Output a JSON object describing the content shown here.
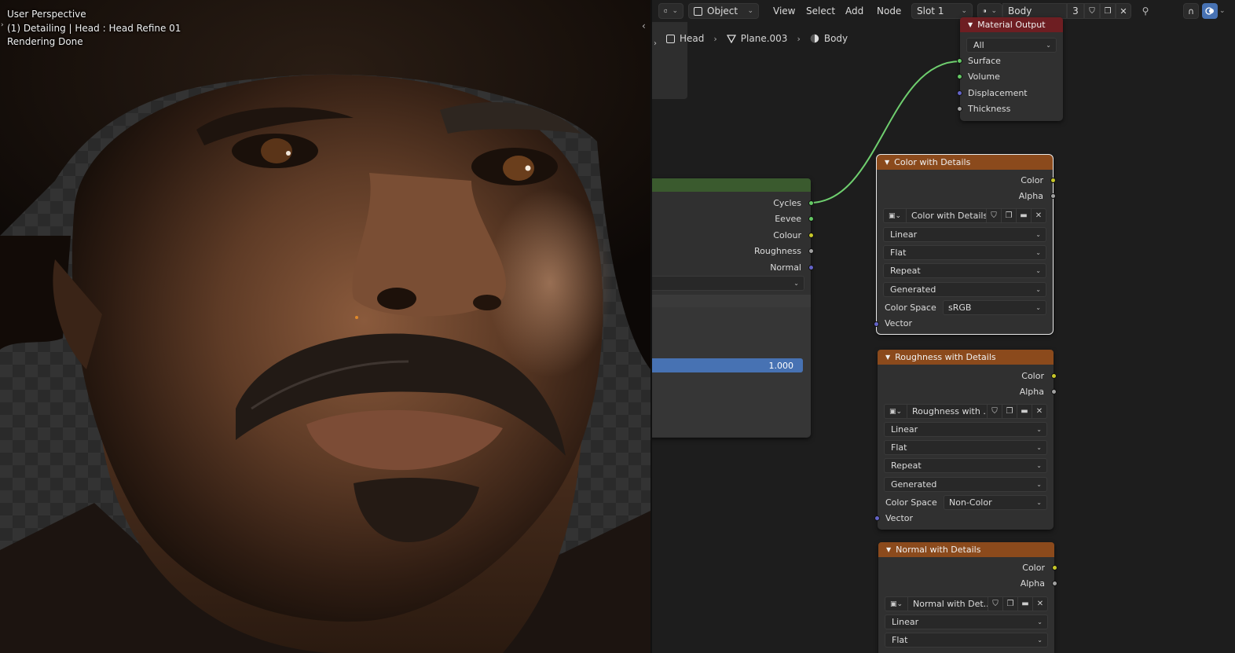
{
  "viewport": {
    "line1": "User Perspective",
    "line2": "(1) Detailing | Head : Head Refine 01",
    "line3": "Rendering Done"
  },
  "header": {
    "mode": "Object",
    "menus": [
      "View",
      "Select",
      "Add",
      "Node"
    ],
    "slot": "Slot 1",
    "material": "Body",
    "users": "3"
  },
  "breadcrumb": {
    "object": "Head",
    "mesh": "Plane.003",
    "material": "Body"
  },
  "group_node": {
    "outputs": [
      "Cycles",
      "Eevee",
      "Colour",
      "Roughness",
      "Normal"
    ],
    "slider_value": "1.000"
  },
  "material_output": {
    "title": "Material Output",
    "target": "All",
    "inputs": [
      "Surface",
      "Volume",
      "Displacement",
      "Thickness"
    ]
  },
  "nodes": [
    {
      "title": "Color with Details",
      "outputs": [
        "Color",
        "Alpha"
      ],
      "image": "Color with Details",
      "interpolation": "Linear",
      "projection": "Flat",
      "extension": "Repeat",
      "source": "Generated",
      "colorspace_label": "Color Space",
      "colorspace": "sRGB",
      "input": "Vector"
    },
    {
      "title": "Roughness with Details",
      "outputs": [
        "Color",
        "Alpha"
      ],
      "image": "Roughness with ...",
      "interpolation": "Linear",
      "projection": "Flat",
      "extension": "Repeat",
      "source": "Generated",
      "colorspace_label": "Color Space",
      "colorspace": "Non-Color",
      "input": "Vector"
    },
    {
      "title": "Normal with Details",
      "outputs": [
        "Color",
        "Alpha"
      ],
      "image": "Normal with Det...",
      "interpolation": "Linear",
      "projection": "Flat"
    }
  ],
  "colors": {
    "node_orange": "#8b4a1c",
    "node_red": "#6e1e22",
    "node_green": "#3a5a2e",
    "socket_yellow": "#c7c729",
    "socket_green": "#63c763",
    "socket_blue": "#6363c7",
    "wire": "#6fcf6f",
    "slider": "#4772b3"
  }
}
